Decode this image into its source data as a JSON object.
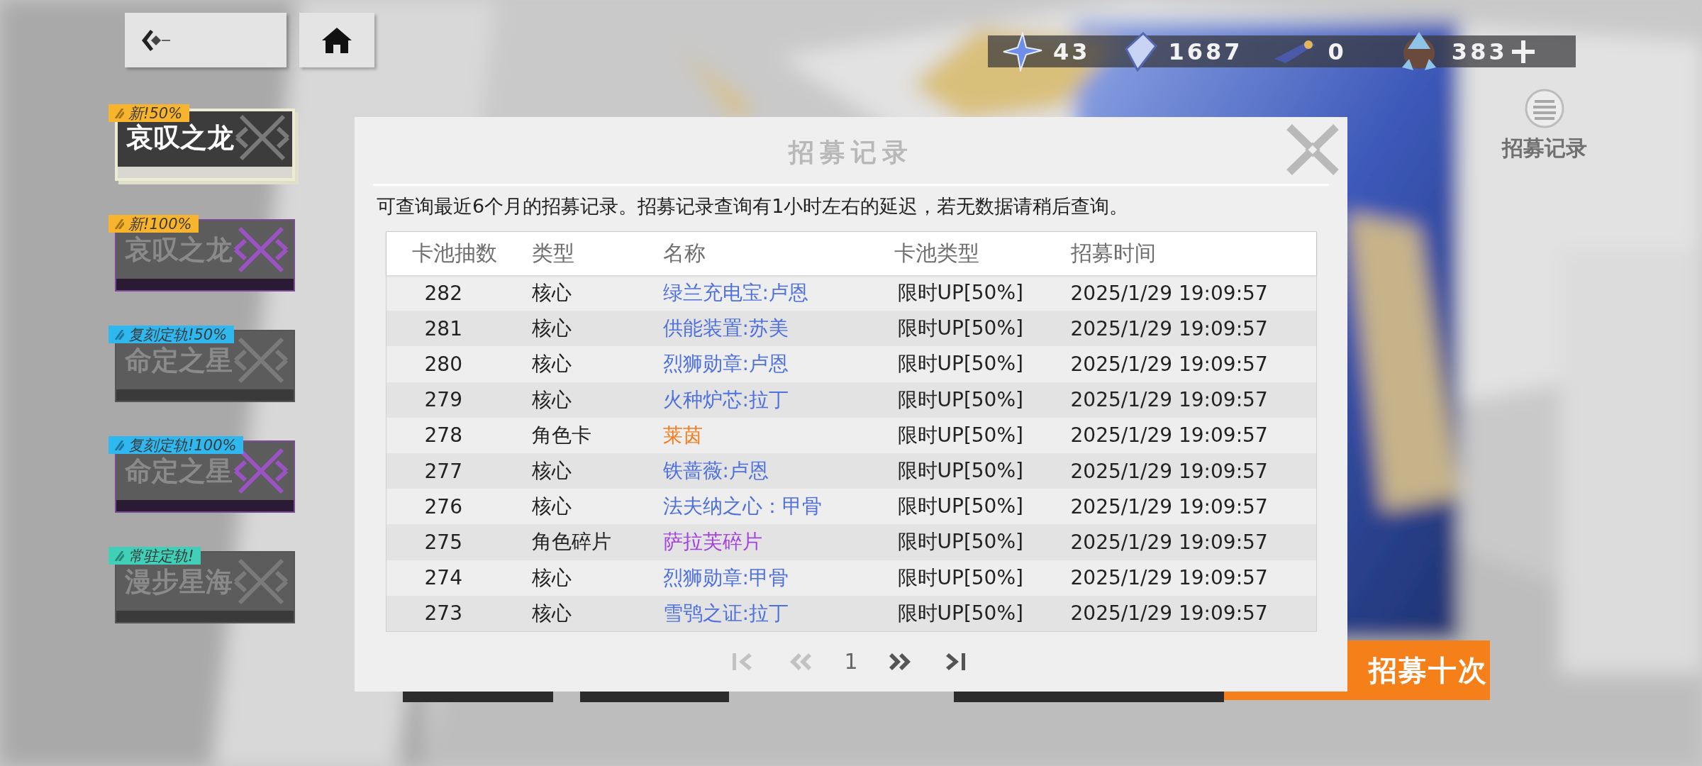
{
  "currencies": [
    {
      "amount": "43"
    },
    {
      "amount": "1687"
    },
    {
      "amount": "0"
    },
    {
      "amount": "383"
    }
  ],
  "banners": [
    {
      "tag": "新!50%",
      "color": "#f8b42c",
      "title": "哀叹之龙",
      "kind": "standard",
      "selected": true
    },
    {
      "tag": "新!100%",
      "color": "#f8b42c",
      "title": "哀叹之龙",
      "kind": "premium",
      "selected": false
    },
    {
      "tag": "复刻定轨!50%",
      "color": "#2fb8f0",
      "title": "命定之星",
      "kind": "standard",
      "selected": false
    },
    {
      "tag": "复刻定轨!100%",
      "color": "#2fb8f0",
      "title": "命定之星",
      "kind": "premium",
      "selected": false
    },
    {
      "tag": "常驻定轨!",
      "color": "#40d0b8",
      "title": "漫步星海",
      "kind": "standard",
      "selected": false
    }
  ],
  "history_button": {
    "label": "招募记录"
  },
  "recruit_ten_button": {
    "label": "招募十次"
  },
  "dialog": {
    "title": "招募记录",
    "notice": "可查询最近6个月的招募记录。招募记录查询有1小时左右的延迟，若无数据请稍后查询。",
    "columns": [
      "卡池抽数",
      "类型",
      "名称",
      "卡池类型",
      "招募时间"
    ],
    "rows": [
      {
        "draws": "282",
        "type": "核心",
        "name": "绿兰充电宝:卢恩",
        "color": "#4f71e0",
        "pool": "限时UP[50%]",
        "time": "2025/1/29 19:09:57"
      },
      {
        "draws": "281",
        "type": "核心",
        "name": "供能装置:苏美",
        "color": "#4f71e0",
        "pool": "限时UP[50%]",
        "time": "2025/1/29 19:09:57"
      },
      {
        "draws": "280",
        "type": "核心",
        "name": "烈狮勋章:卢恩",
        "color": "#4f71e0",
        "pool": "限时UP[50%]",
        "time": "2025/1/29 19:09:57"
      },
      {
        "draws": "279",
        "type": "核心",
        "name": "火种炉芯:拉丁",
        "color": "#4f71e0",
        "pool": "限时UP[50%]",
        "time": "2025/1/29 19:09:57"
      },
      {
        "draws": "278",
        "type": "角色卡",
        "name": "莱茵",
        "color": "#f57d1f",
        "pool": "限时UP[50%]",
        "time": "2025/1/29 19:09:57"
      },
      {
        "draws": "277",
        "type": "核心",
        "name": "铁蔷薇:卢恩",
        "color": "#4f71e0",
        "pool": "限时UP[50%]",
        "time": "2025/1/29 19:09:57"
      },
      {
        "draws": "276",
        "type": "核心",
        "name": "法夫纳之心：甲骨",
        "color": "#4f71e0",
        "pool": "限时UP[50%]",
        "time": "2025/1/29 19:09:57"
      },
      {
        "draws": "275",
        "type": "角色碎片",
        "name": "萨拉芙碎片",
        "color": "#a444e0",
        "pool": "限时UP[50%]",
        "time": "2025/1/29 19:09:57"
      },
      {
        "draws": "274",
        "type": "核心",
        "name": "烈狮勋章:甲骨",
        "color": "#4f71e0",
        "pool": "限时UP[50%]",
        "time": "2025/1/29 19:09:57"
      },
      {
        "draws": "273",
        "type": "核心",
        "name": "雪鸮之证:拉丁",
        "color": "#4f71e0",
        "pool": "限时UP[50%]",
        "time": "2025/1/29 19:09:57"
      }
    ],
    "pagination": [
      {
        "kind": "first",
        "disabled": true
      },
      {
        "kind": "prev",
        "disabled": true
      },
      {
        "kind": "page",
        "label": "1"
      },
      {
        "kind": "next",
        "disabled": false
      },
      {
        "kind": "last",
        "disabled": false
      }
    ]
  }
}
